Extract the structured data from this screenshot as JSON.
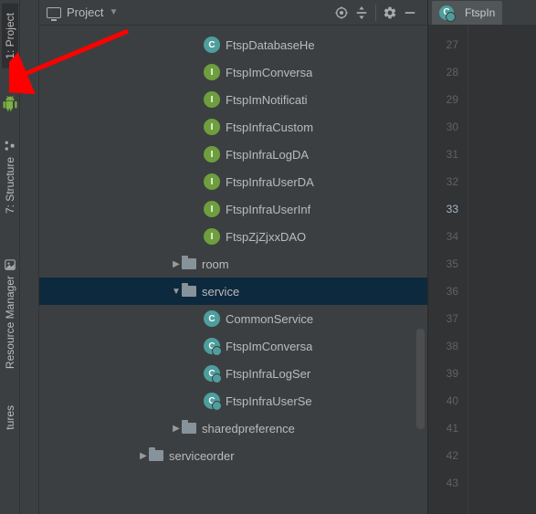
{
  "left_rail": {
    "items": [
      {
        "label": "1: Project"
      },
      {
        "label": "7: Structure"
      },
      {
        "label": "Resource Manager"
      },
      {
        "label": "tures"
      }
    ]
  },
  "panel": {
    "title": "Project"
  },
  "tree": {
    "items": [
      {
        "indent": 5,
        "node": "file",
        "icon": "c",
        "label": "FtspDatabaseHe"
      },
      {
        "indent": 5,
        "node": "file",
        "icon": "i",
        "label": "FtspImConversa"
      },
      {
        "indent": 5,
        "node": "file",
        "icon": "i",
        "label": "FtspImNotificati"
      },
      {
        "indent": 5,
        "node": "file",
        "icon": "i",
        "label": "FtspInfraCustom"
      },
      {
        "indent": 5,
        "node": "file",
        "icon": "i",
        "label": "FtspInfraLogDA"
      },
      {
        "indent": 5,
        "node": "file",
        "icon": "i",
        "label": "FtspInfraUserDA"
      },
      {
        "indent": 5,
        "node": "file",
        "icon": "i",
        "label": "FtspInfraUserInf"
      },
      {
        "indent": 5,
        "node": "file",
        "icon": "i",
        "label": "FtspZjZjxxDAO"
      },
      {
        "indent": 4,
        "node": "dir-closed",
        "label": "room"
      },
      {
        "indent": 4,
        "node": "dir-open",
        "label": "service",
        "selected": true
      },
      {
        "indent": 5,
        "node": "file",
        "icon": "c",
        "label": "CommonService"
      },
      {
        "indent": 5,
        "node": "file",
        "icon": "co",
        "label": "FtspImConversa"
      },
      {
        "indent": 5,
        "node": "file",
        "icon": "co",
        "label": "FtspInfraLogSer"
      },
      {
        "indent": 5,
        "node": "file",
        "icon": "co",
        "label": "FtspInfraUserSe"
      },
      {
        "indent": 4,
        "node": "dir-closed",
        "label": "sharedpreference"
      },
      {
        "indent": 3,
        "node": "dir-closed",
        "label": "serviceorder"
      }
    ]
  },
  "editor": {
    "tab_label": "FtspIn",
    "line_start": 27,
    "line_end": 43,
    "active_line": 33
  }
}
